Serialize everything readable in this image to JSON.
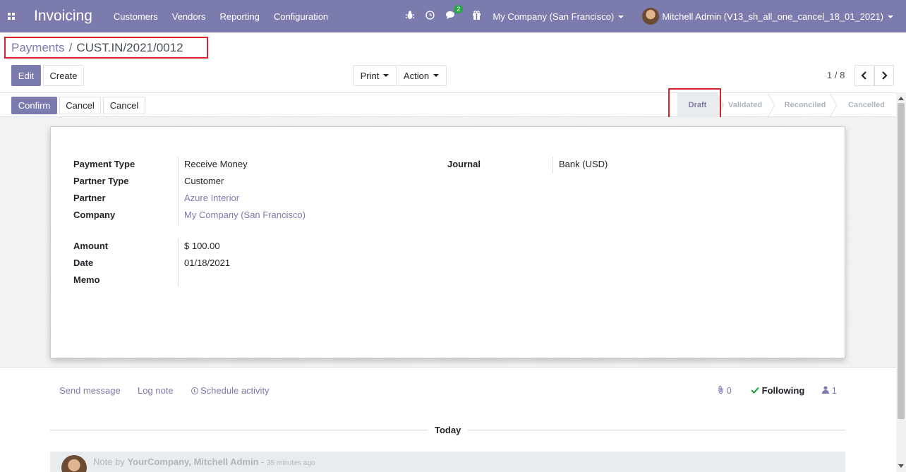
{
  "navbar": {
    "app_title": "Invoicing",
    "menu": [
      "Customers",
      "Vendors",
      "Reporting",
      "Configuration"
    ],
    "chat_badge": "2",
    "company": "My Company (San Francisco)",
    "user": "Mitchell Admin (V13_sh_all_one_cancel_18_01_2021)"
  },
  "breadcrumb": {
    "parent": "Payments",
    "separator": "/",
    "current": "CUST.IN/2021/0012"
  },
  "toolbar": {
    "edit": "Edit",
    "create": "Create",
    "print": "Print",
    "action": "Action",
    "pager": "1 / 8",
    "prev_icon": "chevron-left-icon",
    "next_icon": "chevron-right-icon"
  },
  "statusbar": {
    "buttons": {
      "confirm": "Confirm",
      "cancel_1": "Cancel",
      "cancel_2": "Cancel"
    },
    "stages": [
      "Draft",
      "Validated",
      "Reconciled",
      "Cancelled"
    ],
    "active_stage": "Draft"
  },
  "form": {
    "payment_type_label": "Payment Type",
    "payment_type": "Receive Money",
    "partner_type_label": "Partner Type",
    "partner_type": "Customer",
    "partner_label": "Partner",
    "partner": "Azure Interior",
    "company_label": "Company",
    "company": "My Company (San Francisco)",
    "amount_label": "Amount",
    "amount": "$ 100.00",
    "date_label": "Date",
    "date": "01/18/2021",
    "memo_label": "Memo",
    "memo": "",
    "journal_label": "Journal",
    "journal": "Bank (USD)"
  },
  "chatter": {
    "send_message": "Send message",
    "log_note": "Log note",
    "schedule_activity": "Schedule activity",
    "attachments": "0",
    "following": "Following",
    "followers": "1",
    "today": "Today",
    "note_prefix": "Note by",
    "note_author": "YourCompany, Mitchell Admin",
    "note_sep": " - ",
    "note_time": "35 minutes ago"
  },
  "colors": {
    "brand": "#7c7bad",
    "highlight": "#d9232d",
    "success": "#28a745"
  }
}
